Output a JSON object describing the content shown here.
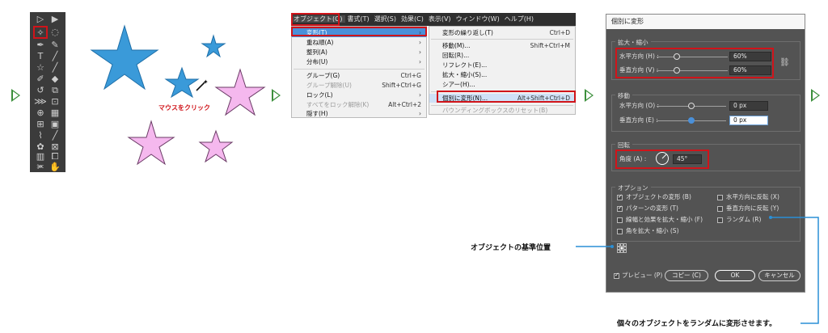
{
  "colors": {
    "accent_red": "#d0141a",
    "arrow_green": "#3c8f3c",
    "star_blue": "#3a9ad9",
    "star_pink": "#f5b8ee",
    "callout_blue": "#2a8fd6"
  },
  "canvas": {
    "click_label": "マウスをクリック"
  },
  "menubar": {
    "items": [
      "オブジェクト(O)",
      "書式(T)",
      "選択(S)",
      "効果(C)",
      "表示(V)",
      "ウィンドウ(W)",
      "ヘルプ(H)"
    ]
  },
  "object_menu": {
    "items": [
      {
        "label": "変形(T)",
        "shortcut": ""
      },
      {
        "label": "重ね順(A)",
        "shortcut": ""
      },
      {
        "label": "整列(A)",
        "shortcut": ""
      },
      {
        "label": "分布(U)",
        "shortcut": ""
      },
      {
        "label": "グループ(G)",
        "shortcut": "Ctrl+G"
      },
      {
        "label": "グループ解除(U)",
        "shortcut": "Shift+Ctrl+G"
      },
      {
        "label": "ロック(L)",
        "shortcut": ""
      },
      {
        "label": "すべてをロック解除(K)",
        "shortcut": "Alt+Ctrl+2"
      },
      {
        "label": "隠す(H)",
        "shortcut": ""
      }
    ]
  },
  "transform_menu": {
    "items": [
      {
        "label": "変形の繰り返し(T)",
        "shortcut": "Ctrl+D"
      },
      {
        "label": "移動(M)...",
        "shortcut": "Shift+Ctrl+M"
      },
      {
        "label": "回転(R)...",
        "shortcut": ""
      },
      {
        "label": "リフレクト(E)...",
        "shortcut": ""
      },
      {
        "label": "拡大・縮小(S)...",
        "shortcut": ""
      },
      {
        "label": "シアー(H)...",
        "shortcut": ""
      },
      {
        "label": "個別に変形(N)...",
        "shortcut": "Alt+Shift+Ctrl+D"
      },
      {
        "label": "バウンディングボックスのリセット(B)",
        "shortcut": ""
      }
    ]
  },
  "dialog": {
    "title": "個別に変形",
    "scale": {
      "label": "拡大・縮小",
      "horizontal_label": "水平方向 (H) :",
      "horizontal_value": "60%",
      "horizontal_fraction": 0.6,
      "vertical_label": "垂直方向 (V) :",
      "vertical_value": "60%",
      "vertical_fraction": 0.6
    },
    "move": {
      "label": "移動",
      "horizontal_label": "水平方向 (O) :",
      "horizontal_value": "0 px",
      "vertical_label": "垂直方向 (E) :",
      "vertical_value": "0 px"
    },
    "rotate": {
      "label": "回転",
      "angle_label": "角度 (A) :",
      "angle_value": "45°"
    },
    "options": {
      "label": "オプション",
      "transform_objects": "オブジェクトの変形 (B)",
      "transform_patterns": "パターンの変形 (T)",
      "scale_strokes": "線幅と効果を拡大・縮小 (F)",
      "scale_corners": "角を拡大・縮小 (S)",
      "reflect_x": "水平方向に反転 (X)",
      "reflect_y": "垂直方向に反転 (Y)",
      "random": "ランダム (R)"
    },
    "preview": "プレビュー (P)",
    "copy": "コピー (C)",
    "ok": "OK",
    "cancel": "キャンセル"
  },
  "annotations": {
    "reference_point": "オブジェクトの基準位置",
    "random_note": "個々のオブジェクトをランダムに変形させます。"
  }
}
